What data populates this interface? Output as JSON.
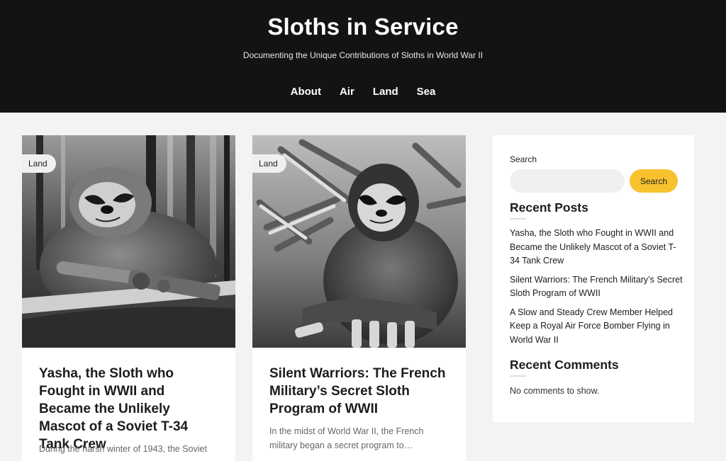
{
  "site": {
    "title": "Sloths in Service",
    "tagline": "Documenting the Unique Contributions of Sloths in World War II"
  },
  "nav": {
    "items": [
      "About",
      "Air",
      "Land",
      "Sea"
    ]
  },
  "posts": [
    {
      "category": "Land",
      "title": "Yasha, the Sloth who Fought in WWII and Became the Unlikely Mascot of a Soviet T-34 Tank Crew",
      "excerpt": "During the harsh winter of 1943, the Soviet"
    },
    {
      "category": "Land",
      "title": "Silent Warriors: The French Military’s Secret Sloth Program of WWII",
      "excerpt": "In the midst of World War II, the French military began a secret program to…"
    }
  ],
  "sidebar": {
    "search": {
      "label": "Search",
      "button": "Search",
      "placeholder": ""
    },
    "recent_posts": {
      "title": "Recent Posts",
      "items": [
        "Yasha, the Sloth who Fought in WWII and Became the Unlikely Mascot of a Soviet T-34 Tank Crew",
        "Silent Warriors: The French Military’s Secret Sloth Program of WWII",
        "A Slow and Steady Crew Member Helped Keep a Royal Air Force Bomber Flying in World War II"
      ]
    },
    "recent_comments": {
      "title": "Recent Comments",
      "empty_text": "No comments to show."
    }
  },
  "colors": {
    "header_bg": "#121315",
    "page_bg": "#f3f3f3",
    "accent": "#f7c22e"
  }
}
